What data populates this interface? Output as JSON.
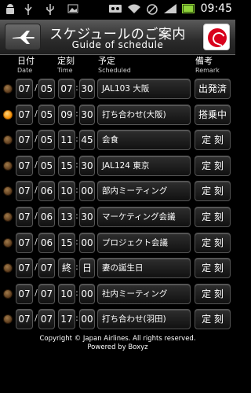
{
  "statusbar": {
    "time": "09:45",
    "icons": [
      "android-icon",
      "usb-debug-icon",
      "usb-icon",
      "image-icon",
      "voicemail-icon",
      "wifi-icon",
      "no-sim-icon",
      "signal-icon",
      "battery-icon"
    ]
  },
  "header": {
    "title": "スケジュールのご案内",
    "subtitle": "Guide of schedule"
  },
  "columns": {
    "date": "日付",
    "date_en": "Date",
    "time": "定刻",
    "time_en": "Time",
    "scheduled": "予定",
    "scheduled_en": "Scheduled",
    "remark": "備考",
    "remark_en": "Remark"
  },
  "rows": [
    {
      "month": "07",
      "day": "05",
      "hh": "07",
      "mm": "30",
      "item": "JAL103 大阪",
      "remark": "出発済",
      "active": false
    },
    {
      "month": "07",
      "day": "05",
      "hh": "09",
      "mm": "30",
      "item": "打ち合わせ(大阪)",
      "remark": "搭乗中",
      "active": true
    },
    {
      "month": "07",
      "day": "05",
      "hh": "11",
      "mm": "45",
      "item": "会食",
      "remark": "定 刻",
      "active": false
    },
    {
      "month": "07",
      "day": "05",
      "hh": "15",
      "mm": "30",
      "item": "JAL124 東京",
      "remark": "定 刻",
      "active": false
    },
    {
      "month": "07",
      "day": "06",
      "hh": "10",
      "mm": "00",
      "item": "部内ミーティング",
      "remark": "定 刻",
      "active": false
    },
    {
      "month": "07",
      "day": "06",
      "hh": "13",
      "mm": "30",
      "item": "マーケティング会議",
      "remark": "定 刻",
      "active": false
    },
    {
      "month": "07",
      "day": "06",
      "hh": "15",
      "mm": "00",
      "item": "プロジェクト会議",
      "remark": "定 刻",
      "active": false
    },
    {
      "month": "07",
      "day": "07",
      "hh": "終",
      "mm": "日",
      "item": "妻の誕生日",
      "remark": "定 刻",
      "active": false
    },
    {
      "month": "07",
      "day": "07",
      "hh": "10",
      "mm": "00",
      "item": "社内ミーティング",
      "remark": "定 刻",
      "active": false
    },
    {
      "month": "07",
      "day": "07",
      "hh": "17",
      "mm": "00",
      "item": "打ち合わせ(羽田)",
      "remark": "定 刻",
      "active": false
    }
  ],
  "footer": {
    "copyright": "Copyright © Japan Airlines. All rights reserved.",
    "powered": "Powered by Boxyz"
  }
}
